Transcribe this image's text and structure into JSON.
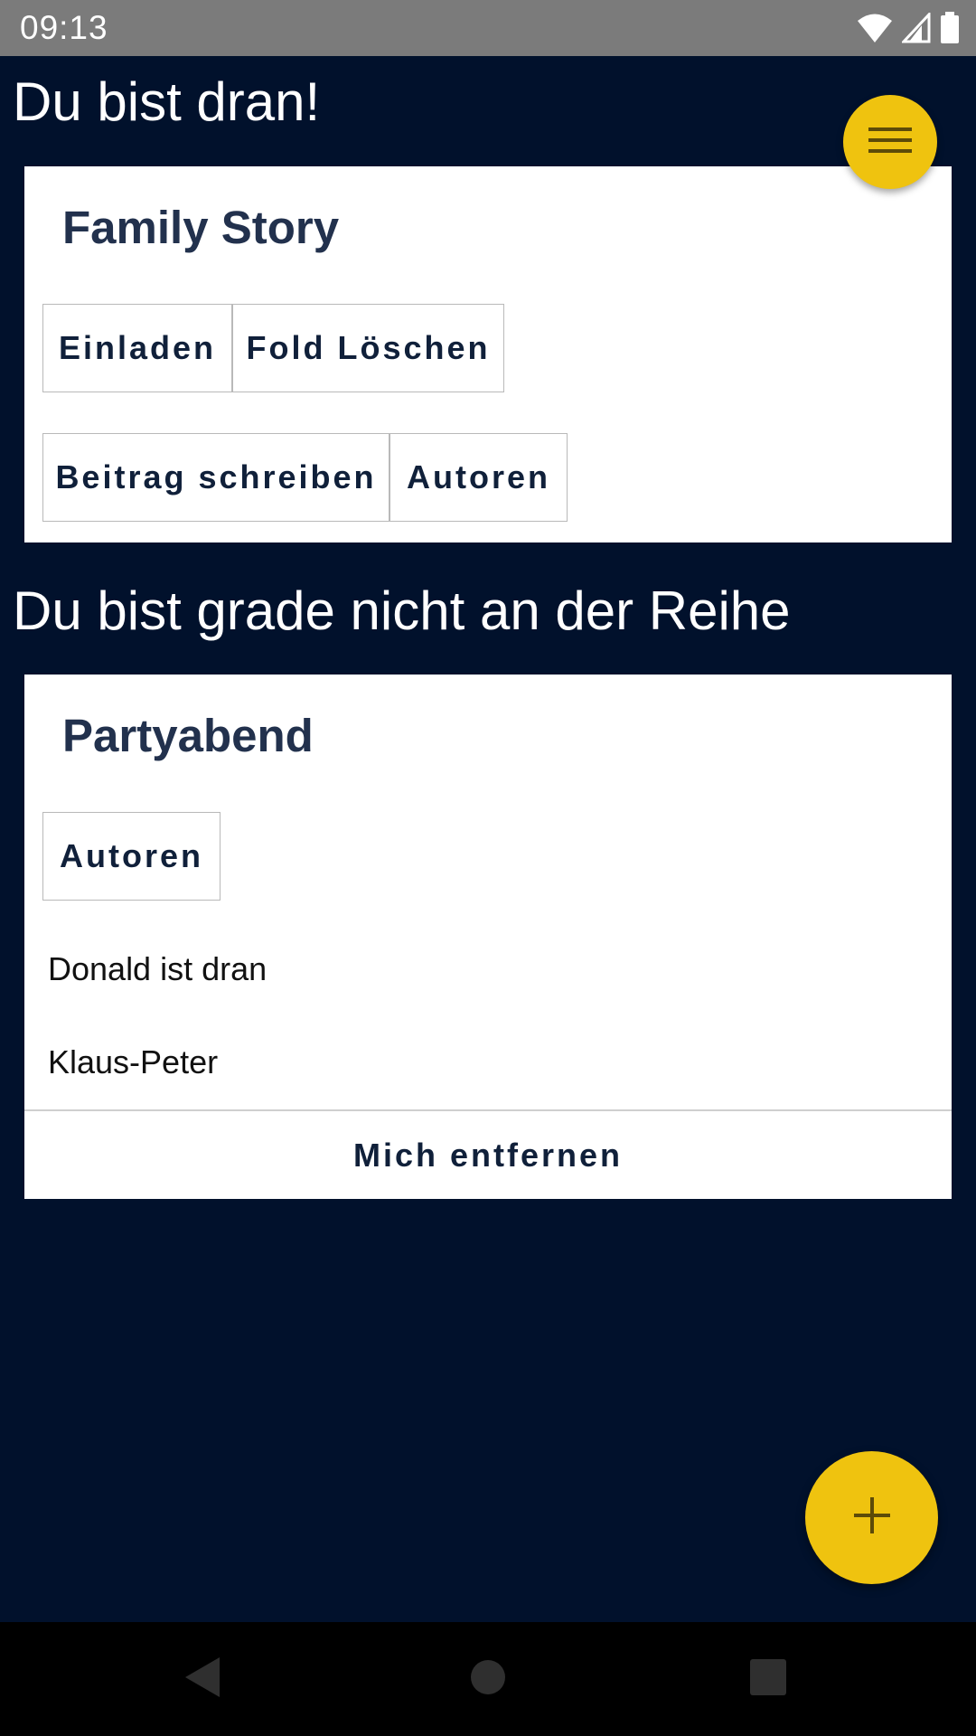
{
  "status_bar": {
    "time": "09:13",
    "icons": [
      "wifi-icon",
      "cell-signal-icon",
      "battery-icon"
    ]
  },
  "sections": {
    "my_turn_title": "Du bist dran!",
    "not_my_turn_title": "Du bist grade nicht an der Reihe"
  },
  "family_story": {
    "title": "Family Story",
    "buttons": {
      "invite": "Einladen",
      "delete_fold": "Fold Löschen",
      "write_post": "Beitrag schreiben",
      "authors": "Autoren"
    }
  },
  "partyabend": {
    "title": "Partyabend",
    "authors_button": "Autoren",
    "authors_list": [
      "Donald ist dran",
      "Klaus-Peter"
    ],
    "remove_me_button": "Mich entfernen"
  },
  "fabs": {
    "menu_icon": "menu-icon",
    "add_icon": "plus-icon"
  },
  "colors": {
    "background": "#01112c",
    "accent": "#efc30f",
    "card": "#ffffff",
    "card_title": "#22314d"
  },
  "nav_bar": {
    "icons": [
      "back-icon",
      "home-icon",
      "recents-icon"
    ]
  }
}
